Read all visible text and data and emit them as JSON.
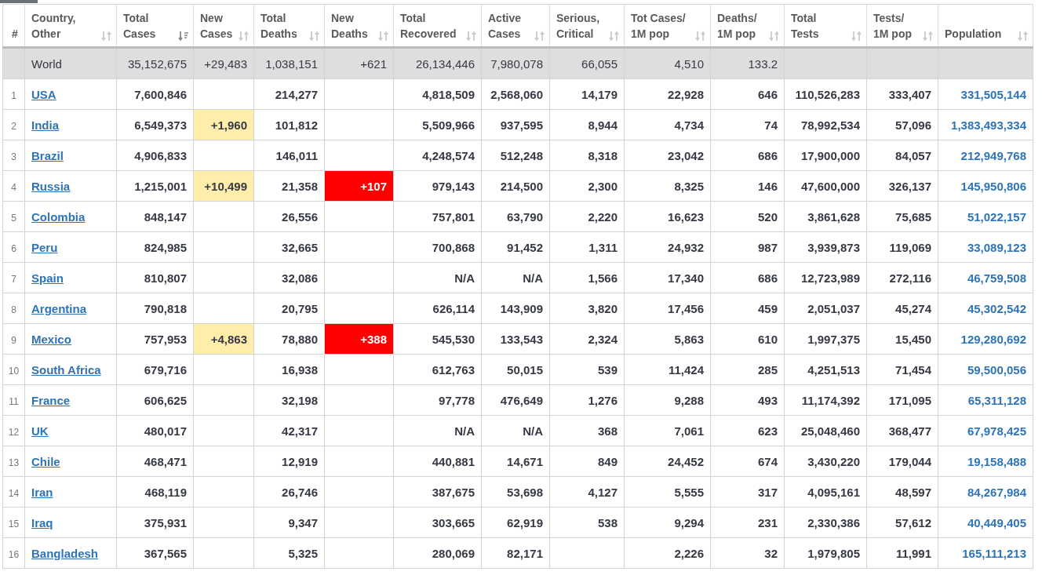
{
  "columns": [
    {
      "lines": [
        "#"
      ]
    },
    {
      "lines": [
        "Country,",
        "Other"
      ],
      "sorted": false
    },
    {
      "lines": [
        "Total",
        "Cases"
      ],
      "sorted": true
    },
    {
      "lines": [
        "New",
        "Cases"
      ],
      "sorted": false
    },
    {
      "lines": [
        "Total",
        "Deaths"
      ],
      "sorted": false
    },
    {
      "lines": [
        "New",
        "Deaths"
      ],
      "sorted": false
    },
    {
      "lines": [
        "Total",
        "Recovered"
      ],
      "sorted": false
    },
    {
      "lines": [
        "Active",
        "Cases"
      ],
      "sorted": false
    },
    {
      "lines": [
        "Serious,",
        "Critical"
      ],
      "sorted": false
    },
    {
      "lines": [
        "Tot Cases/",
        "1M pop"
      ],
      "sorted": false
    },
    {
      "lines": [
        "Deaths/",
        "1M pop"
      ],
      "sorted": false
    },
    {
      "lines": [
        "Total",
        "Tests"
      ],
      "sorted": false
    },
    {
      "lines": [
        "Tests/",
        "1M pop"
      ],
      "sorted": false
    },
    {
      "lines": [
        "Population"
      ],
      "sorted": false
    }
  ],
  "world": {
    "country": "World",
    "total_cases": "35,152,675",
    "new_cases": "+29,483",
    "total_deaths": "1,038,151",
    "new_deaths": "+621",
    "total_recovered": "26,134,446",
    "active_cases": "7,980,078",
    "serious": "66,055",
    "cases_per_1m": "4,510",
    "deaths_per_1m": "133.2"
  },
  "rows": [
    {
      "rank": "1",
      "country": "USA",
      "total_cases": "7,600,846",
      "total_deaths": "214,277",
      "total_recovered": "4,818,509",
      "active_cases": "2,568,060",
      "serious": "14,179",
      "cases_per_1m": "22,928",
      "deaths_per_1m": "646",
      "total_tests": "110,526,283",
      "tests_per_1m": "333,407",
      "population": "331,505,144"
    },
    {
      "rank": "2",
      "country": "India",
      "total_cases": "6,549,373",
      "new_cases": "+1,960",
      "total_deaths": "101,812",
      "total_recovered": "5,509,966",
      "active_cases": "937,595",
      "serious": "8,944",
      "cases_per_1m": "4,734",
      "deaths_per_1m": "74",
      "total_tests": "78,992,534",
      "tests_per_1m": "57,096",
      "population": "1,383,493,334"
    },
    {
      "rank": "3",
      "country": "Brazil",
      "total_cases": "4,906,833",
      "total_deaths": "146,011",
      "total_recovered": "4,248,574",
      "active_cases": "512,248",
      "serious": "8,318",
      "cases_per_1m": "23,042",
      "deaths_per_1m": "686",
      "total_tests": "17,900,000",
      "tests_per_1m": "84,057",
      "population": "212,949,768"
    },
    {
      "rank": "4",
      "country": "Russia",
      "total_cases": "1,215,001",
      "new_cases": "+10,499",
      "total_deaths": "21,358",
      "new_deaths": "+107",
      "total_recovered": "979,143",
      "active_cases": "214,500",
      "serious": "2,300",
      "cases_per_1m": "8,325",
      "deaths_per_1m": "146",
      "total_tests": "47,600,000",
      "tests_per_1m": "326,137",
      "population": "145,950,806"
    },
    {
      "rank": "5",
      "country": "Colombia",
      "total_cases": "848,147",
      "total_deaths": "26,556",
      "total_recovered": "757,801",
      "active_cases": "63,790",
      "serious": "2,220",
      "cases_per_1m": "16,623",
      "deaths_per_1m": "520",
      "total_tests": "3,861,628",
      "tests_per_1m": "75,685",
      "population": "51,022,157"
    },
    {
      "rank": "6",
      "country": "Peru",
      "total_cases": "824,985",
      "total_deaths": "32,665",
      "total_recovered": "700,868",
      "active_cases": "91,452",
      "serious": "1,311",
      "cases_per_1m": "24,932",
      "deaths_per_1m": "987",
      "total_tests": "3,939,873",
      "tests_per_1m": "119,069",
      "population": "33,089,123"
    },
    {
      "rank": "7",
      "country": "Spain",
      "total_cases": "810,807",
      "total_deaths": "32,086",
      "total_recovered": "N/A",
      "active_cases": "N/A",
      "serious": "1,566",
      "cases_per_1m": "17,340",
      "deaths_per_1m": "686",
      "total_tests": "12,723,989",
      "tests_per_1m": "272,116",
      "population": "46,759,508"
    },
    {
      "rank": "8",
      "country": "Argentina",
      "total_cases": "790,818",
      "total_deaths": "20,795",
      "total_recovered": "626,114",
      "active_cases": "143,909",
      "serious": "3,820",
      "cases_per_1m": "17,456",
      "deaths_per_1m": "459",
      "total_tests": "2,051,037",
      "tests_per_1m": "45,274",
      "population": "45,302,542"
    },
    {
      "rank": "9",
      "country": "Mexico",
      "total_cases": "757,953",
      "new_cases": "+4,863",
      "total_deaths": "78,880",
      "new_deaths": "+388",
      "total_recovered": "545,530",
      "active_cases": "133,543",
      "serious": "2,324",
      "cases_per_1m": "5,863",
      "deaths_per_1m": "610",
      "total_tests": "1,997,375",
      "tests_per_1m": "15,450",
      "population": "129,280,692"
    },
    {
      "rank": "10",
      "country": "South Africa",
      "total_cases": "679,716",
      "total_deaths": "16,938",
      "total_recovered": "612,763",
      "active_cases": "50,015",
      "serious": "539",
      "cases_per_1m": "11,424",
      "deaths_per_1m": "285",
      "total_tests": "4,251,513",
      "tests_per_1m": "71,454",
      "population": "59,500,056"
    },
    {
      "rank": "11",
      "country": "France",
      "total_cases": "606,625",
      "total_deaths": "32,198",
      "total_recovered": "97,778",
      "active_cases": "476,649",
      "serious": "1,276",
      "cases_per_1m": "9,288",
      "deaths_per_1m": "493",
      "total_tests": "11,174,392",
      "tests_per_1m": "171,095",
      "population": "65,311,128"
    },
    {
      "rank": "12",
      "country": "UK",
      "total_cases": "480,017",
      "total_deaths": "42,317",
      "total_recovered": "N/A",
      "active_cases": "N/A",
      "serious": "368",
      "cases_per_1m": "7,061",
      "deaths_per_1m": "623",
      "total_tests": "25,048,460",
      "tests_per_1m": "368,477",
      "population": "67,978,425"
    },
    {
      "rank": "13",
      "country": "Chile",
      "total_cases": "468,471",
      "total_deaths": "12,919",
      "total_recovered": "440,881",
      "active_cases": "14,671",
      "serious": "849",
      "cases_per_1m": "24,452",
      "deaths_per_1m": "674",
      "total_tests": "3,430,220",
      "tests_per_1m": "179,044",
      "population": "19,158,488"
    },
    {
      "rank": "14",
      "country": "Iran",
      "total_cases": "468,119",
      "total_deaths": "26,746",
      "total_recovered": "387,675",
      "active_cases": "53,698",
      "serious": "4,127",
      "cases_per_1m": "5,555",
      "deaths_per_1m": "317",
      "total_tests": "4,095,161",
      "tests_per_1m": "48,597",
      "population": "84,267,984"
    },
    {
      "rank": "15",
      "country": "Iraq",
      "total_cases": "375,931",
      "total_deaths": "9,347",
      "total_recovered": "303,665",
      "active_cases": "62,919",
      "serious": "538",
      "cases_per_1m": "9,294",
      "deaths_per_1m": "231",
      "total_tests": "2,330,386",
      "tests_per_1m": "57,612",
      "population": "40,449,405"
    },
    {
      "rank": "16",
      "country": "Bangladesh",
      "total_cases": "367,565",
      "total_deaths": "5,325",
      "total_recovered": "280,069",
      "active_cases": "82,171",
      "cases_per_1m": "2,226",
      "deaths_per_1m": "32",
      "total_tests": "1,979,805",
      "tests_per_1m": "11,991",
      "population": "165,111,213"
    }
  ]
}
